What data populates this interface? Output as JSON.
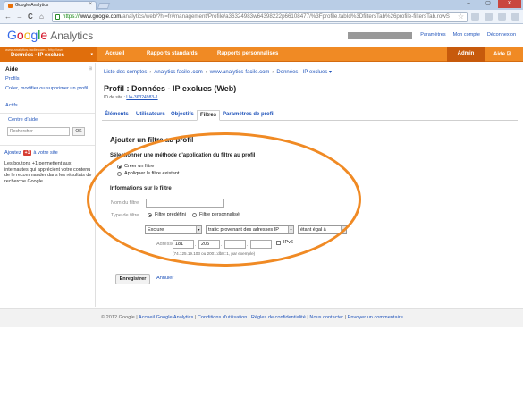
{
  "browser": {
    "tab_title": "Google Analytics",
    "tab_close": "×",
    "url_scheme": "https://",
    "url_host": "www.google.com",
    "url_path": "/analytics/web/?hl=fr#management/Profile/a36324983w64398222p66108477/%3Fprofile.tabId%3DfiltersTab%26profile-filtersTab.rowS",
    "nav_back": "←",
    "nav_forward": "→",
    "nav_reload": "C",
    "nav_home": "⌂",
    "star": "☆",
    "win_min": "–",
    "win_max": "▢",
    "win_close": "✕"
  },
  "header": {
    "logo_letters": [
      "G",
      "o",
      "o",
      "g",
      "l",
      "e"
    ],
    "logo_product": "Analytics",
    "link_parametres": "Paramètres",
    "link_mon_compte": "Mon compte",
    "link_deconnexion": "Déconnexion"
  },
  "nav": {
    "profile_small": "www.analytics-facile.com - http://ww",
    "profile_name": "Données - IP exclues",
    "profile_caret": "▾",
    "accueil": "Accueil",
    "rapports_standards": "Rapports standards",
    "rapports_perso": "Rapports personnalisés",
    "admin": "Admin",
    "aide": "Aide ☑"
  },
  "sidebar": {
    "title": "Aide",
    "close": "⊞",
    "links": [
      "Profils",
      "Créer, modifier ou supprimer un profil",
      "Actifs"
    ],
    "centre_aide": "Centre d'aide",
    "search_placeholder": "Rechercher",
    "ok": "OK",
    "ajoutez": "Ajoutez",
    "gplus": "+1",
    "a_votre_site": "à votre site",
    "promo_text": "Les boutons +1 permettent aux internautes qui apprécient votre contenu de le recommander dans les résultats de recherche Google."
  },
  "breadcrumb": {
    "items": [
      "Liste des comptes",
      "Analytics facile .com",
      "www.analytics-facile.com",
      "Données - IP exclues ▾"
    ],
    "separator": "›"
  },
  "profile": {
    "title": "Profil : Données - IP exclues (Web)",
    "id_label": "ID de site :",
    "id_value": "UA-36324983-1"
  },
  "tabs": [
    "Éléments",
    "Utilisateurs",
    "Objectifs",
    "Filtres",
    "Paramètres de profil"
  ],
  "active_tab": "Filtres",
  "form": {
    "heading": "Ajouter un filtre au profil",
    "method_heading": "Sélectionner une méthode d'application du filtre au profil",
    "radio_create": "Créer un filtre",
    "radio_apply": "Appliquer le filtre existant",
    "info_heading": "Informations sur le filtre",
    "name_label": "Nom du filtre",
    "name_value": "",
    "type_label": "Type de filtre",
    "type_predefined": "Filtre prédéfini",
    "type_custom": "Filtre personnalisé",
    "select_action": "Exclure",
    "select_source": "trafic provenant des adresses IP",
    "select_operator": "étant égal à",
    "ip_label": "Adresse IP",
    "ip_octets": [
      "181",
      "205",
      "",
      ""
    ],
    "ipv6_label": "IPv6",
    "ip_hint": "(74.125.19.103 ou 2001:db8::1, par exemple)",
    "save": "Enregistrer",
    "cancel": "Annuler"
  },
  "footer": {
    "copyright": "© 2012 Google",
    "links": [
      "Accueil Google Analytics",
      "Conditions d'utilisation",
      "Règles de confidentialité",
      "Nous contacter",
      "Envoyer un commentaire"
    ],
    "separator": "|"
  },
  "colors": {
    "accent_orange": "#f08a24",
    "admin_dark": "#c75a0c",
    "link_blue": "#2255bb",
    "highlight_ring": "#f08a24"
  }
}
